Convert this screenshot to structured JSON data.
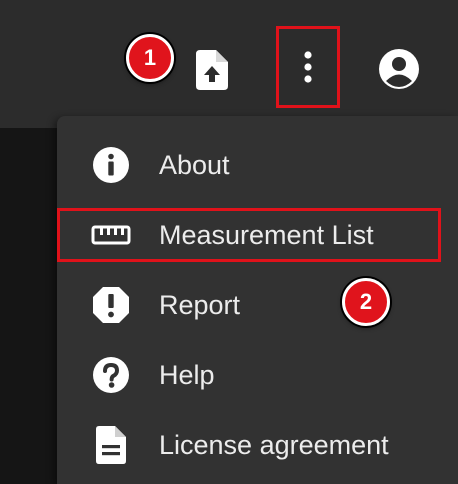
{
  "toolbar": {
    "upload_icon": "file-upload-icon",
    "more_icon": "more-vertical-icon",
    "account_icon": "account-circle-icon"
  },
  "menu": {
    "items": [
      {
        "label": "About",
        "icon": "info-icon"
      },
      {
        "label": "Measurement List",
        "icon": "ruler-icon"
      },
      {
        "label": "Report",
        "icon": "report-icon"
      },
      {
        "label": "Help",
        "icon": "help-icon"
      },
      {
        "label": "License agreement",
        "icon": "document-icon"
      }
    ]
  },
  "annotations": {
    "step1": "1",
    "step2": "2",
    "highlight_color": "#e0121a"
  }
}
